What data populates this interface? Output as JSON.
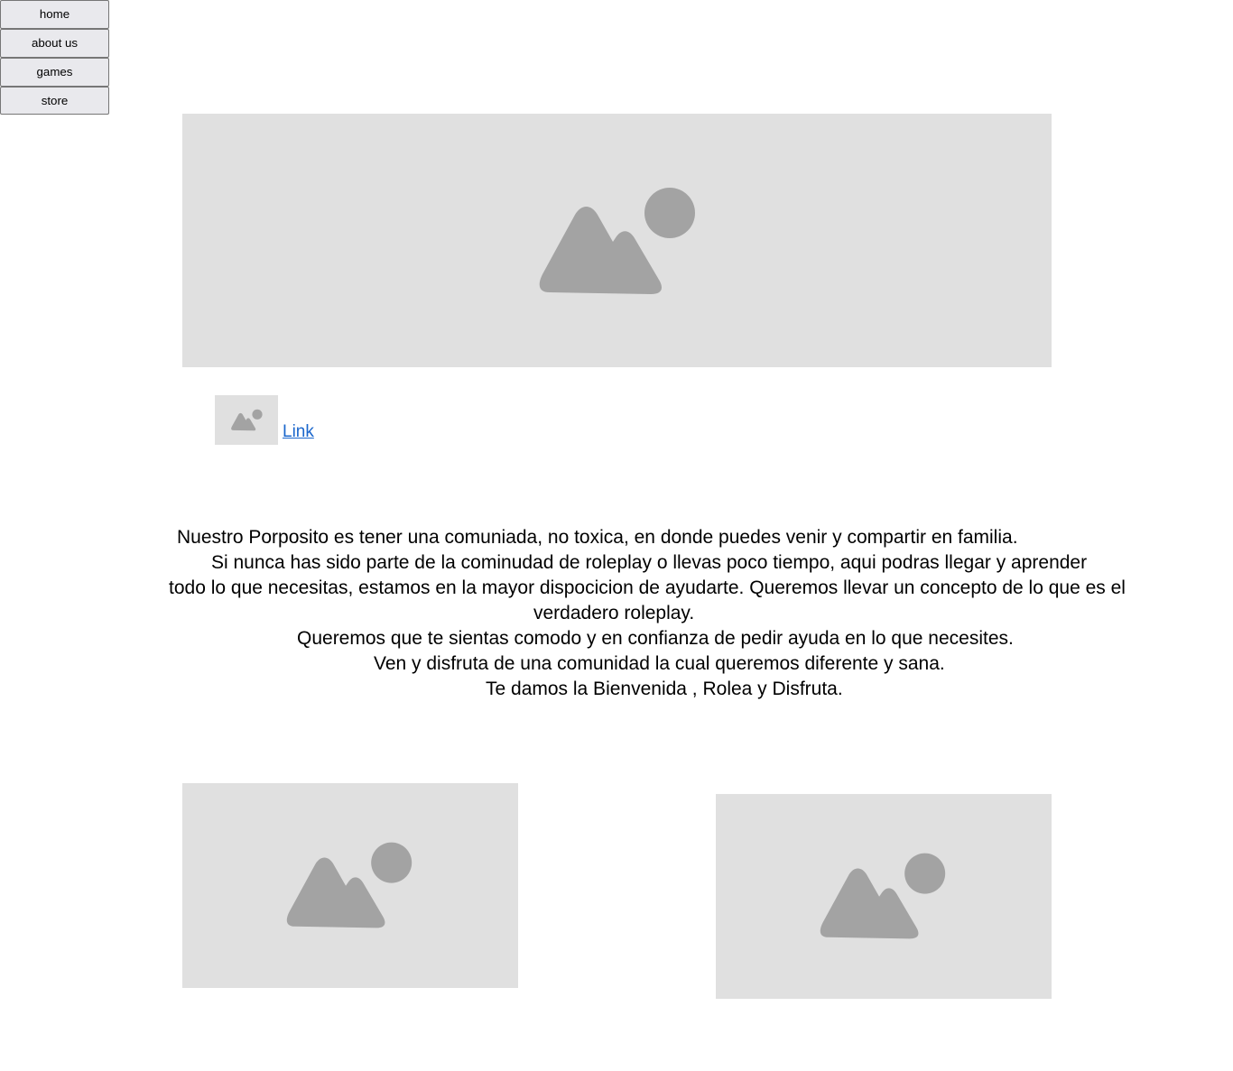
{
  "nav": {
    "home": "home",
    "about": "about us",
    "games": "games",
    "store": "store"
  },
  "link": {
    "label": "Link"
  },
  "intro": {
    "line1": "Nuestro Porposito es tener una comuniada, no toxica, en donde puedes venir y compartir en familia.",
    "line2": "Si nunca has sido parte de la cominudad de roleplay o llevas poco tiempo, aqui podras llegar y aprender",
    "line3": "todo lo que necesitas, estamos en la mayor dispocicion de ayudarte. Queremos llevar un concepto de lo que es el",
    "line4": "verdadero roleplay.",
    "line5": "Queremos que te sientas comodo y en confianza de pedir ayuda en lo que necesites.",
    "line6": "Ven y disfruta de una comunidad la cual queremos diferente y sana.",
    "line7": "Te damos la Bienvenida , Rolea y Disfruta."
  },
  "colors": {
    "placeholder_bg": "#e0e0e0",
    "placeholder_icon": "#a3a3a3",
    "link": "#1a66cc"
  },
  "icons": {
    "placeholder": "image-placeholder-icon"
  }
}
